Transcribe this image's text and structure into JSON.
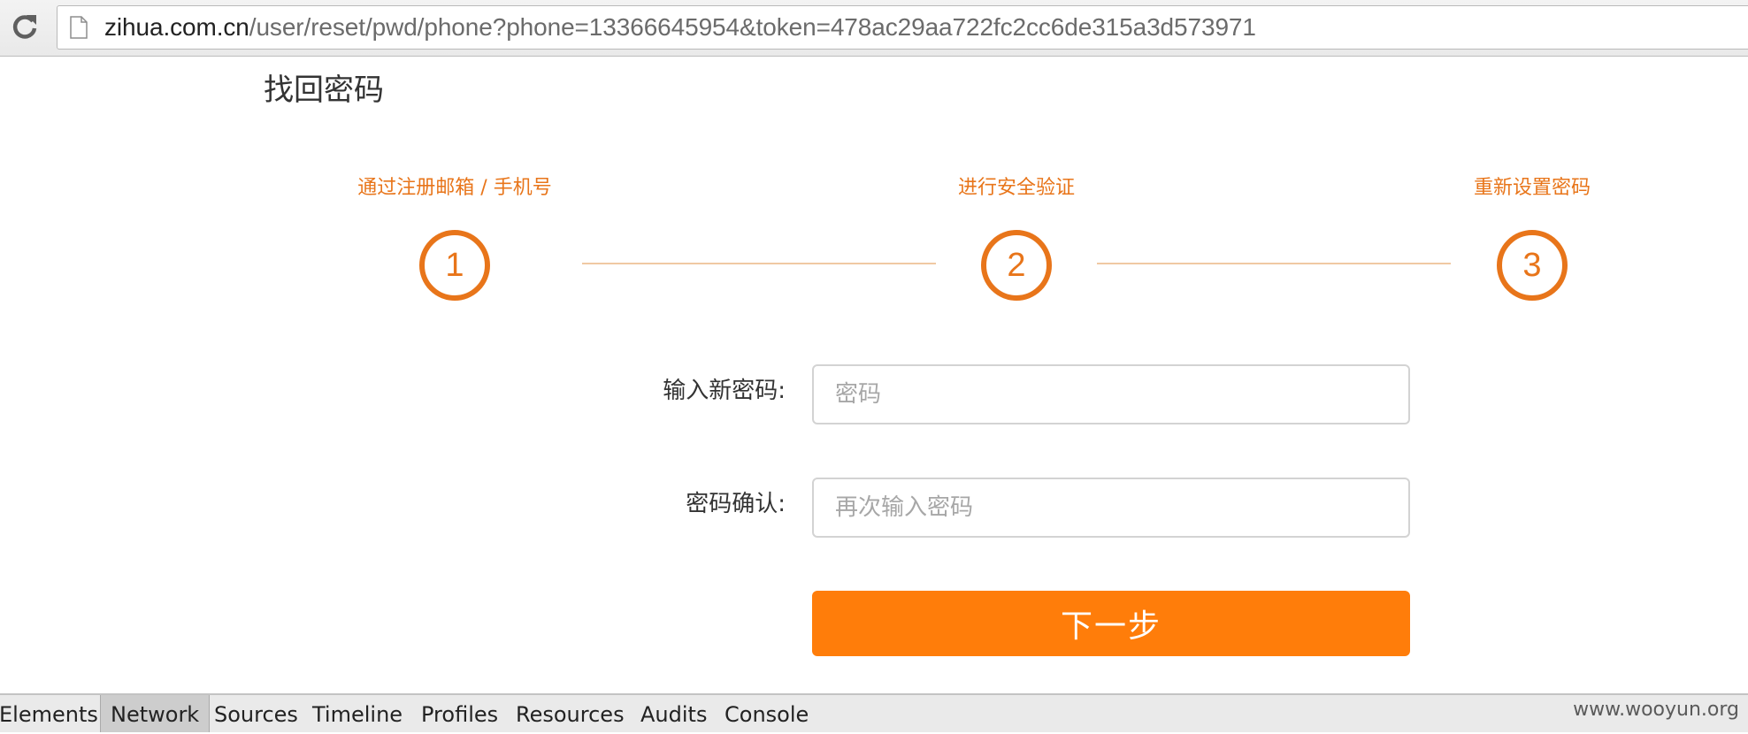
{
  "browser": {
    "url_host": "zihua.com.cn",
    "url_path": "/user/reset/pwd/phone?phone=13366645954&token=478ac29aa722fc2cc6de315a3d573971",
    "reload_icon": "reload-icon",
    "page_icon": "page-icon"
  },
  "page": {
    "title": "找回密码"
  },
  "steps": [
    {
      "label": "通过注册邮箱 / 手机号",
      "number": "1"
    },
    {
      "label": "进行安全验证",
      "number": "2"
    },
    {
      "label": "重新设置密码",
      "number": "3"
    }
  ],
  "form": {
    "new_password": {
      "label": "输入新密码:",
      "value": "",
      "placeholder": "密码"
    },
    "confirm_password": {
      "label": "密码确认:",
      "value": "",
      "placeholder": "再次输入密码"
    },
    "next_button_label": "下一步"
  },
  "devtools": {
    "tabs": [
      "Elements",
      "Network",
      "Sources",
      "Timeline",
      "Profiles",
      "Resources",
      "Audits",
      "Console"
    ],
    "active_tab": "Network"
  },
  "watermark": "www.wooyun.org",
  "colors": {
    "accent": "#ff7d0a",
    "step_orange": "#e8751a"
  }
}
